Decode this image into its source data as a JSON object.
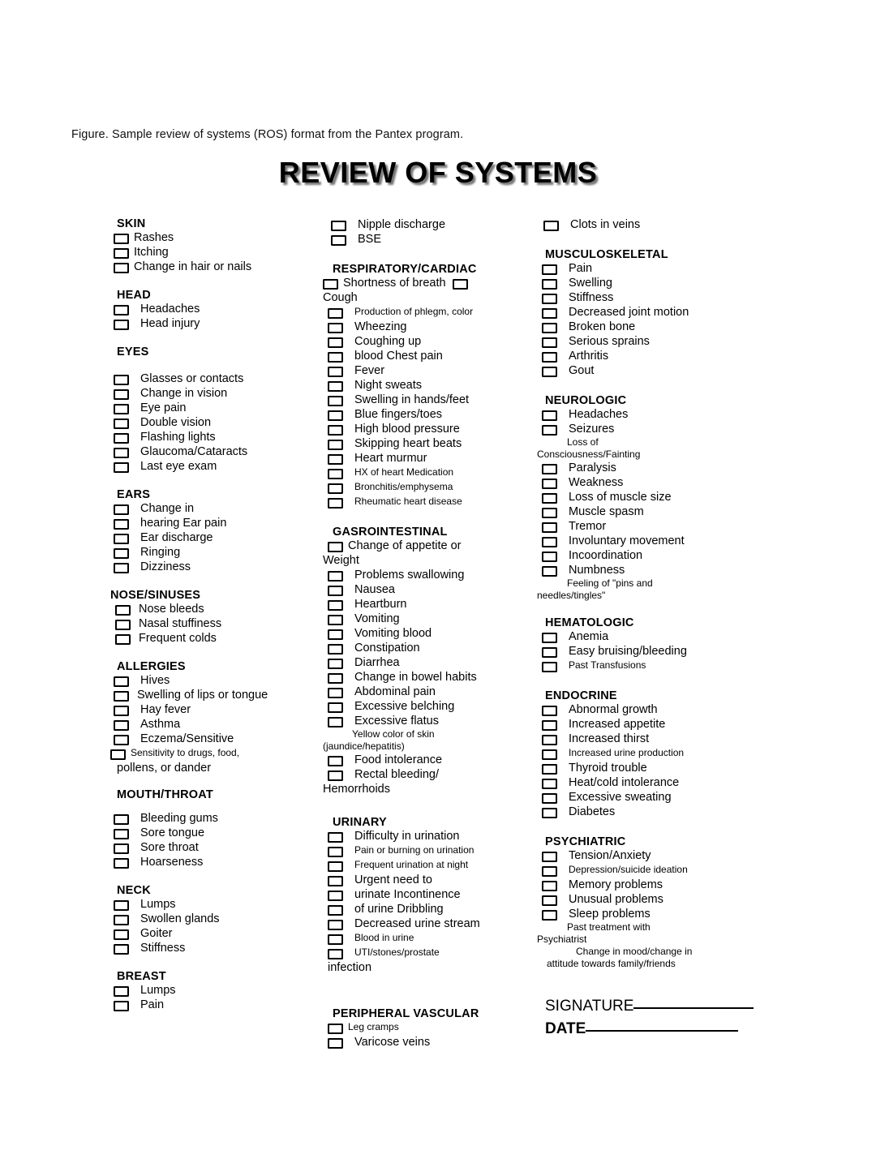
{
  "caption": "Figure. Sample review of systems (ROS) format from the Pantex program.",
  "title": "REVIEW OF SYSTEMS",
  "signature": {
    "signature_label": "SIGNATURE",
    "date_label": "DATE"
  },
  "columns": [
    {
      "id": "column-1",
      "sections": [
        {
          "heading": "SKIN",
          "items": [
            {
              "label": "Rashes",
              "checkbox": true
            },
            {
              "label": "Itching",
              "checkbox": true
            },
            {
              "label": "Change in hair or nails",
              "checkbox": true
            }
          ]
        },
        {
          "heading": "HEAD",
          "items": [
            {
              "label": "Headaches",
              "checkbox": true
            },
            {
              "label": "Head injury",
              "checkbox": true
            }
          ]
        },
        {
          "heading": "EYES",
          "items": [
            {
              "label": "Glasses or contacts",
              "checkbox": true
            },
            {
              "label": "Change in vision",
              "checkbox": true
            },
            {
              "label": "Eye pain",
              "checkbox": true
            },
            {
              "label": "Double vision",
              "checkbox": true
            },
            {
              "label": "Flashing lights",
              "checkbox": true
            },
            {
              "label": "Glaucoma/Cataracts",
              "checkbox": true
            },
            {
              "label": "Last eye exam",
              "checkbox": true
            }
          ]
        },
        {
          "heading": "EARS",
          "items": [
            {
              "label": "Change in",
              "checkbox": true
            },
            {
              "label": "hearing Ear pain",
              "checkbox": true
            },
            {
              "label": "Ear discharge",
              "checkbox": true
            },
            {
              "label": "Ringing",
              "checkbox": true
            },
            {
              "label": "Dizziness",
              "checkbox": true
            }
          ]
        },
        {
          "heading": "NOSE/SINUSES",
          "items": [
            {
              "label": "Nose bleeds",
              "checkbox": true
            },
            {
              "label": "Nasal stuffiness",
              "checkbox": true
            },
            {
              "label": "Frequent colds",
              "checkbox": true
            }
          ]
        },
        {
          "heading": "ALLERGIES",
          "items": [
            {
              "label": "Hives",
              "checkbox": true
            },
            {
              "label": "Swelling of lips or tongue",
              "checkbox": true
            },
            {
              "label": "Hay fever",
              "checkbox": true
            },
            {
              "label": "Asthma",
              "checkbox": true
            },
            {
              "label": "Eczema/Sensitive",
              "checkbox": true
            },
            {
              "label": "Sensitivity to drugs, food,",
              "checkbox": true,
              "small": true
            },
            {
              "label": "pollens, or dander",
              "checkbox": false,
              "small": false
            }
          ]
        },
        {
          "heading": "MOUTH/THROAT",
          "items": [
            {
              "label": "Bleeding gums",
              "checkbox": true
            },
            {
              "label": "Sore tongue",
              "checkbox": true
            },
            {
              "label": "Sore throat",
              "checkbox": true
            },
            {
              "label": "Hoarseness",
              "checkbox": true
            }
          ]
        },
        {
          "heading": "NECK",
          "items": [
            {
              "label": "Lumps",
              "checkbox": true
            },
            {
              "label": "Swollen glands",
              "checkbox": true
            },
            {
              "label": "Goiter",
              "checkbox": true
            },
            {
              "label": "Stiffness",
              "checkbox": true
            }
          ]
        },
        {
          "heading": "BREAST",
          "items": [
            {
              "label": "Lumps",
              "checkbox": true
            },
            {
              "label": "Pain",
              "checkbox": true
            }
          ]
        }
      ]
    },
    {
      "id": "column-2",
      "sections": [
        {
          "heading": "",
          "items": [
            {
              "label": "Nipple discharge",
              "checkbox": true
            },
            {
              "label": "BSE",
              "checkbox": true
            }
          ]
        },
        {
          "heading": "RESPIRATORY/CARDIAC",
          "items": [
            {
              "label": "Shortness of breath",
              "checkbox": true,
              "trailing_checkbox": true
            },
            {
              "label": "Cough",
              "checkbox": false
            },
            {
              "label": "Production of phlegm, color",
              "checkbox": true,
              "small": true
            },
            {
              "label": "Wheezing",
              "checkbox": true
            },
            {
              "label": "Coughing up",
              "checkbox": true
            },
            {
              "label": "blood Chest pain",
              "checkbox": true
            },
            {
              "label": "Fever",
              "checkbox": true
            },
            {
              "label": "Night sweats",
              "checkbox": true
            },
            {
              "label": "Swelling in hands/feet",
              "checkbox": true
            },
            {
              "label": "Blue fingers/toes",
              "checkbox": true
            },
            {
              "label": "High blood pressure",
              "checkbox": true
            },
            {
              "label": "Skipping heart beats",
              "checkbox": true
            },
            {
              "label": "Heart murmur",
              "checkbox": true
            },
            {
              "label": "HX of heart Medication",
              "checkbox": true,
              "small": true
            },
            {
              "label": "Bronchitis/emphysema",
              "checkbox": true,
              "small": true
            },
            {
              "label": "Rheumatic heart disease",
              "checkbox": true,
              "small": true
            }
          ]
        },
        {
          "heading": "GASROINTESTINAL",
          "items": [
            {
              "label": "Change of appetite or",
              "checkbox": true
            },
            {
              "label": "Weight",
              "checkbox": false
            },
            {
              "label": "Problems swallowing",
              "checkbox": true
            },
            {
              "label": "Nausea",
              "checkbox": true
            },
            {
              "label": "Heartburn",
              "checkbox": true
            },
            {
              "label": "Vomiting",
              "checkbox": true
            },
            {
              "label": "Vomiting blood",
              "checkbox": true
            },
            {
              "label": "Constipation",
              "checkbox": true
            },
            {
              "label": "Diarrhea",
              "checkbox": true
            },
            {
              "label": "Change in bowel habits",
              "checkbox": true
            },
            {
              "label": "Abdominal pain",
              "checkbox": true
            },
            {
              "label": "Excessive belching",
              "checkbox": true
            },
            {
              "label": "Excessive flatus",
              "checkbox": true
            },
            {
              "label": "Yellow color of skin",
              "checkbox": false,
              "small": true
            },
            {
              "label": "(jaundice/hepatitis)",
              "checkbox": false,
              "small": true
            },
            {
              "label": "Food intolerance",
              "checkbox": true
            },
            {
              "label": "Rectal bleeding/",
              "checkbox": true
            },
            {
              "label": "Hemorrhoids",
              "checkbox": false
            }
          ]
        },
        {
          "heading": "URINARY",
          "items": [
            {
              "label": "Difficulty in urination",
              "checkbox": true
            },
            {
              "label": "Pain or burning on urination",
              "checkbox": true,
              "small": true
            },
            {
              "label": "Frequent urination at night",
              "checkbox": true,
              "small": true
            },
            {
              "label": "Urgent need to",
              "checkbox": true
            },
            {
              "label": "urinate Incontinence",
              "checkbox": true
            },
            {
              "label": "of urine Dribbling",
              "checkbox": true
            },
            {
              "label": "Decreased urine stream",
              "checkbox": true
            },
            {
              "label": "Blood in urine",
              "checkbox": true,
              "small": true
            },
            {
              "label": "UTI/stones/prostate",
              "checkbox": true,
              "small": true
            },
            {
              "label": "infection",
              "checkbox": false
            }
          ]
        },
        {
          "heading": "PERIPHERAL VASCULAR",
          "items": [
            {
              "label": "Leg cramps",
              "checkbox": true,
              "small": true
            },
            {
              "label": "Varicose veins",
              "checkbox": true
            }
          ]
        }
      ]
    },
    {
      "id": "column-3",
      "sections": [
        {
          "heading": "",
          "items": [
            {
              "label": "Clots in veins",
              "checkbox": true
            }
          ]
        },
        {
          "heading": "MUSCULOSKELETAL",
          "items": [
            {
              "label": "Pain",
              "checkbox": true
            },
            {
              "label": "Swelling",
              "checkbox": true
            },
            {
              "label": "Stiffness",
              "checkbox": true
            },
            {
              "label": "Decreased joint motion",
              "checkbox": true
            },
            {
              "label": "Broken bone",
              "checkbox": true
            },
            {
              "label": "Serious sprains",
              "checkbox": true
            },
            {
              "label": "Arthritis",
              "checkbox": true
            },
            {
              "label": "Gout",
              "checkbox": true
            }
          ]
        },
        {
          "heading": "NEUROLOGIC",
          "items": [
            {
              "label": "Headaches",
              "checkbox": true
            },
            {
              "label": "Seizures",
              "checkbox": true
            },
            {
              "label": "Loss of",
              "checkbox": false,
              "small": true
            },
            {
              "label": "Consciousness/Fainting",
              "checkbox": false,
              "small": true
            },
            {
              "label": "Paralysis",
              "checkbox": true
            },
            {
              "label": "Weakness",
              "checkbox": true
            },
            {
              "label": "Loss of muscle size",
              "checkbox": true
            },
            {
              "label": "Muscle spasm",
              "checkbox": true
            },
            {
              "label": "Tremor",
              "checkbox": true
            },
            {
              "label": "Involuntary movement",
              "checkbox": true
            },
            {
              "label": "Incoordination",
              "checkbox": true
            },
            {
              "label": "Numbness",
              "checkbox": true
            },
            {
              "label": "Feeling of \"pins and",
              "checkbox": false,
              "small": true
            },
            {
              "label": "needles/tingles\"",
              "checkbox": false,
              "small": true
            }
          ]
        },
        {
          "heading": "HEMATOLOGIC",
          "items": [
            {
              "label": "Anemia",
              "checkbox": true
            },
            {
              "label": "Easy bruising/bleeding",
              "checkbox": true
            },
            {
              "label": "Past Transfusions",
              "checkbox": true,
              "small": true
            }
          ]
        },
        {
          "heading": "ENDOCRINE",
          "items": [
            {
              "label": "Abnormal growth",
              "checkbox": true
            },
            {
              "label": "Increased appetite",
              "checkbox": true
            },
            {
              "label": "Increased thirst",
              "checkbox": true
            },
            {
              "label": "Increased urine production",
              "checkbox": true,
              "small": true
            },
            {
              "label": "Thyroid trouble",
              "checkbox": true
            },
            {
              "label": "Heat/cold intolerance",
              "checkbox": true
            },
            {
              "label": "Excessive sweating",
              "checkbox": true
            },
            {
              "label": "Diabetes",
              "checkbox": true
            }
          ]
        },
        {
          "heading": "PSYCHIATRIC",
          "items": [
            {
              "label": "Tension/Anxiety",
              "checkbox": true
            },
            {
              "label": "Depression/suicide ideation",
              "checkbox": true,
              "small": true
            },
            {
              "label": "Memory problems",
              "checkbox": true
            },
            {
              "label": "Unusual problems",
              "checkbox": true
            },
            {
              "label": "Sleep problems",
              "checkbox": true
            },
            {
              "label": "Past treatment with",
              "checkbox": false,
              "small": true
            },
            {
              "label": "Psychiatrist",
              "checkbox": false,
              "small": true
            },
            {
              "label": "Change in mood/change in",
              "checkbox": false,
              "small": true
            },
            {
              "label": "attitude towards family/friends",
              "checkbox": false,
              "small": true
            }
          ]
        }
      ]
    }
  ]
}
